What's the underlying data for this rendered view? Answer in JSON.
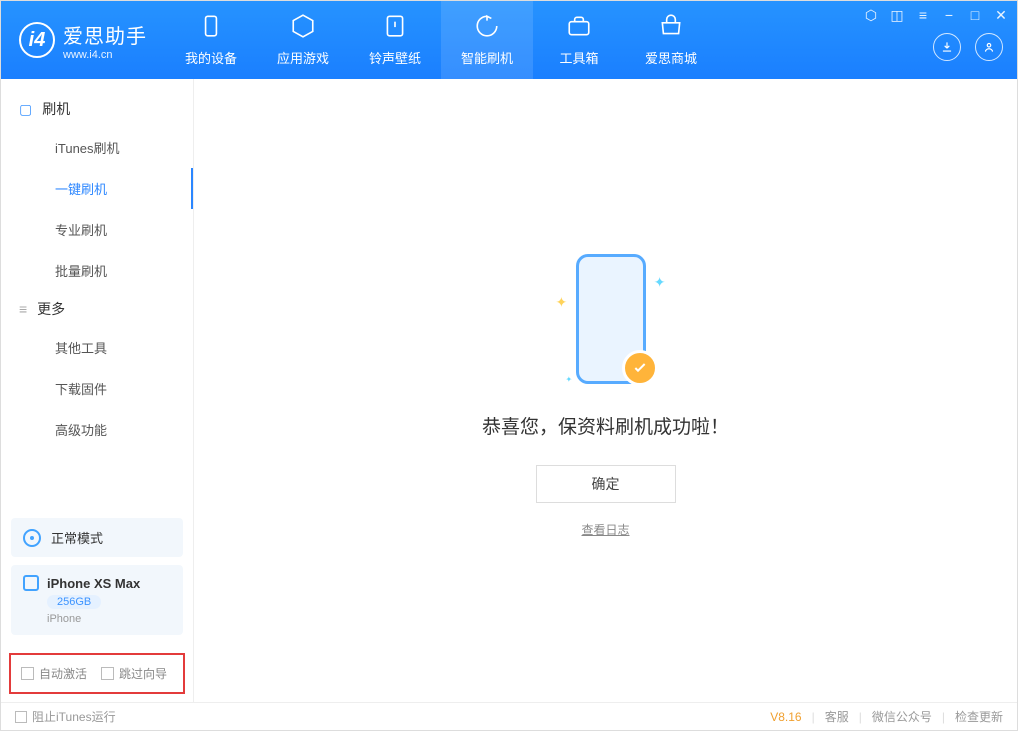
{
  "app": {
    "title": "爱思助手",
    "subtitle": "www.i4.cn"
  },
  "tabs": {
    "mydevice": "我的设备",
    "apps": "应用游戏",
    "ringtones": "铃声壁纸",
    "flash": "智能刷机",
    "tools": "工具箱",
    "store": "爱思商城"
  },
  "sidebar": {
    "section_flash": "刷机",
    "items_flash": [
      "iTunes刷机",
      "一键刷机",
      "专业刷机",
      "批量刷机"
    ],
    "section_more": "更多",
    "items_more": [
      "其他工具",
      "下载固件",
      "高级功能"
    ]
  },
  "mode": {
    "label": "正常模式"
  },
  "device": {
    "name": "iPhone XS Max",
    "storage": "256GB",
    "type": "iPhone"
  },
  "checks": {
    "auto_activate": "自动激活",
    "skip_guide": "跳过向导"
  },
  "main": {
    "success": "恭喜您，保资料刷机成功啦！",
    "ok": "确定",
    "view_log": "查看日志"
  },
  "status": {
    "block_itunes": "阻止iTunes运行",
    "version": "V8.16",
    "support": "客服",
    "wechat": "微信公众号",
    "update": "检查更新"
  }
}
